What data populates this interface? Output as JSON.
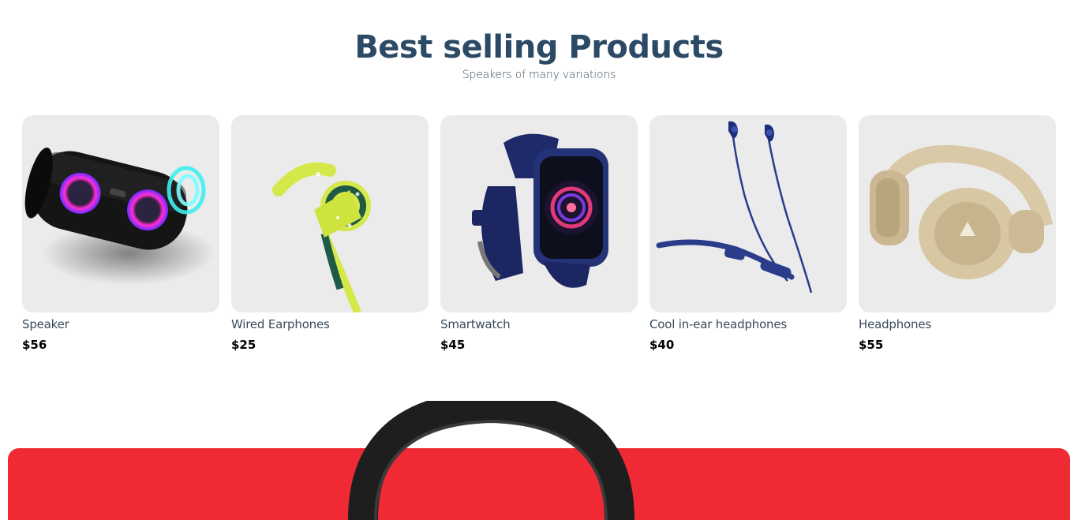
{
  "section": {
    "title": "Best selling Products",
    "subtitle": "Speakers of many variations"
  },
  "products": [
    {
      "name": "Speaker",
      "price": "$56",
      "icon": "speaker-icon"
    },
    {
      "name": "Wired Earphones",
      "price": "$25",
      "icon": "earphones-icon"
    },
    {
      "name": "Smartwatch",
      "price": "$45",
      "icon": "smartwatch-icon"
    },
    {
      "name": "Cool in-ear headphones",
      "price": "$40",
      "icon": "neckband-icon"
    },
    {
      "name": "Headphones",
      "price": "$55",
      "icon": "headphones-icon"
    }
  ],
  "colors": {
    "title": "#2c4a66",
    "card_bg": "#ebebeb",
    "promo_band": "#f02a35"
  }
}
